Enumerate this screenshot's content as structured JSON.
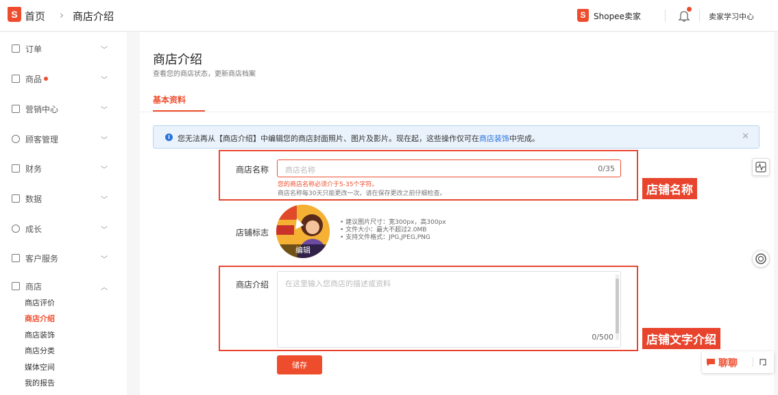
{
  "header": {
    "logo_letter": "S",
    "breadcrumb_home": "首页",
    "breadcrumb_sep": "›",
    "breadcrumb_current": "商店介绍",
    "seller_logo_letter": "S",
    "seller_brand": "Shopee卖家",
    "learning_center": "卖家学习中心"
  },
  "sidebar": {
    "items": [
      {
        "label": "订单"
      },
      {
        "label": "商品"
      },
      {
        "label": "营销中心"
      },
      {
        "label": "顾客管理"
      },
      {
        "label": "财务"
      },
      {
        "label": "数据"
      },
      {
        "label": "成长"
      },
      {
        "label": "客户服务"
      },
      {
        "label": "商店"
      }
    ],
    "shop_sub_items": [
      {
        "label": "商店评价",
        "active": false
      },
      {
        "label": "商店介绍",
        "active": true
      },
      {
        "label": "商店装饰",
        "active": false
      },
      {
        "label": "商店分类",
        "active": false
      },
      {
        "label": "媒体空间",
        "active": false
      },
      {
        "label": "我的报告",
        "active": false
      }
    ]
  },
  "main": {
    "title": "商店介绍",
    "subtitle": "查看您的商店状态，更新商店档案",
    "tab_basic": "基本资料",
    "notice": {
      "before_link": "您无法再从【商店介绍】中编辑您的商店封面照片、图片及影片。现在起，这些操作仅可在",
      "link": "商店装饰",
      "after_link": "中完成。"
    },
    "shop_name": {
      "label": "商店名称",
      "placeholder": "商店名称",
      "count": "0/35",
      "error": "您的商店名称必须介于5-35个字符。",
      "hint": "商店名称每30天只能更改一次。请在保存更改之前仔细检查。"
    },
    "shop_logo": {
      "label": "店铺标志",
      "edit": "编辑",
      "specs": [
        "• 建议图片尺寸：宽300px，高300px",
        "• 文件大小：最大不超过2.0MB",
        "• 支持文件格式：JPG,JPEG,PNG"
      ]
    },
    "shop_desc": {
      "label": "商店介绍",
      "placeholder": "在这里输入您商店的描述或资料",
      "count": "0/500"
    },
    "save_label": "储存"
  },
  "annotations": {
    "name_tag": "店铺名称",
    "desc_tag": "店铺文字介绍"
  },
  "chat": {
    "label": "聊聊"
  },
  "colors": {
    "brand": "#ee4d2d",
    "info": "#2673dd"
  }
}
